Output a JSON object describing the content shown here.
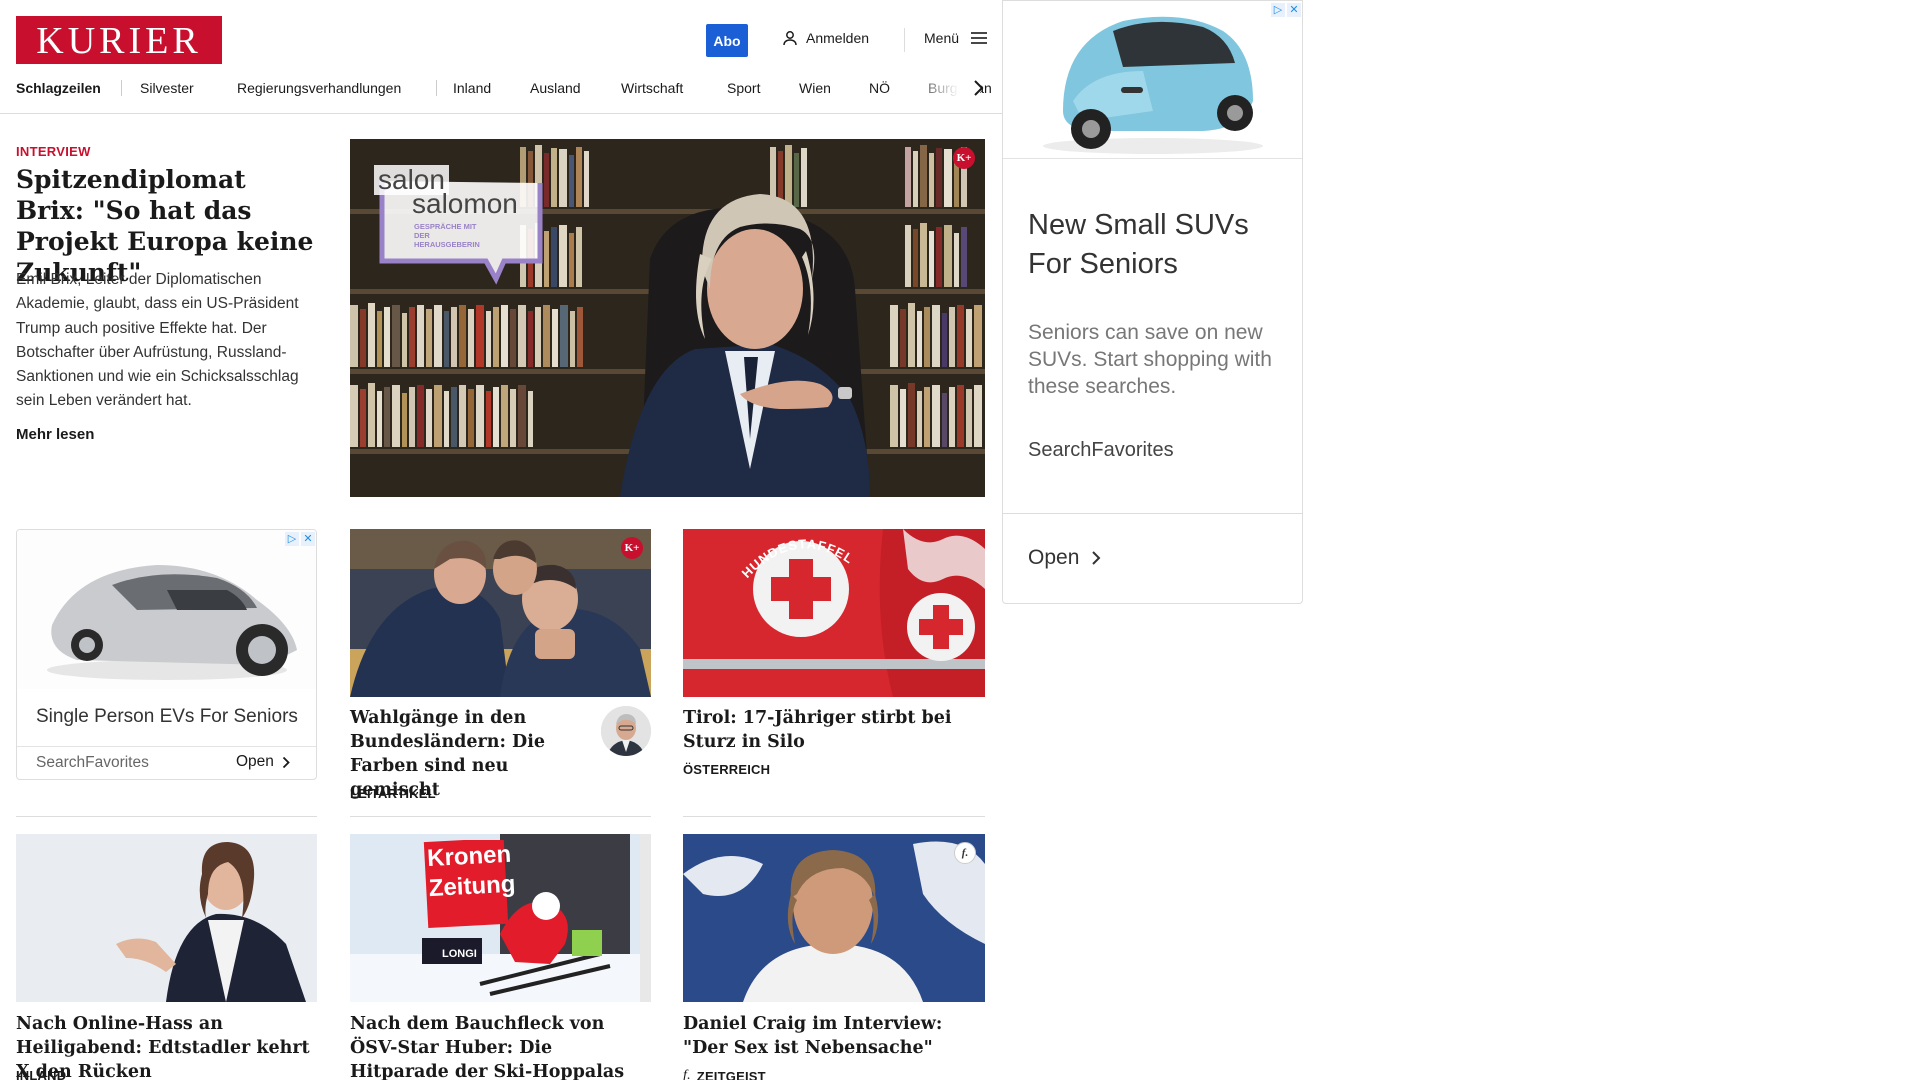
{
  "header": {
    "logo_text": "KURIER",
    "abo_label": "Abo",
    "login_label": "Anmelden",
    "menu_label": "Menü"
  },
  "nav": {
    "items": [
      "Schlagzeilen",
      "Silvester",
      "Regierungsverhandlungen",
      "Inland",
      "Ausland",
      "Wirtschaft",
      "Sport",
      "Wien",
      "NÖ",
      "Burgenland"
    ]
  },
  "hero": {
    "kicker": "INTERVIEW",
    "title": "Spitzendiplomat Brix: \"So hat das Projekt Europa keine Zukunft\"",
    "teaser": "Emil Brix, Leiter der Diplomatischen Akademie, glaubt, dass ein US-Präsident Trump auch positive Effekte hat. Der Botschafter über Aufrüstung, Russland-Sanktionen und wie ein Schicksalsschlag sein Leben verändert hat.",
    "read_more": "Mehr lesen",
    "overlay_brand_line1": "salon",
    "overlay_brand_line2": "salomon",
    "overlay_subtitle": "GESPRÄCHE MIT DER HERAUSGEBERIN",
    "premium_badge": "K+"
  },
  "articles": [
    {
      "title": "Wahlgänge in den Bundes­ländern: Die Farben sind neu gemischt",
      "category": "LEITARTIKEL",
      "badge": "K+"
    },
    {
      "title": "Tirol: 17-Jähriger stirbt bei Sturz in Silo",
      "category": "ÖSTERREICH",
      "image_text": "HUNDESTAFFEL"
    },
    {
      "title": "Nach Online-Hass an Heiligabend: Edtstadler kehrt X den Rücken",
      "category": "INLAND"
    },
    {
      "title": "Nach dem Bauchfleck von ÖSV-Star Huber: Die Hitparade der Ski-Hoppalas",
      "category": "",
      "image_text_1": "Kronen",
      "image_text_2": "Zeitung",
      "image_text_3": "LONGI"
    },
    {
      "title": "Daniel Craig im Interview: \"Der Sex ist Nebensache\"",
      "category": "ZEITGEIST",
      "category_icon_text": "f.",
      "badge": "f."
    }
  ],
  "ad_small": {
    "title": "Single Person EVs For Seniors",
    "source": "SearchFavorites",
    "open_label": "Open"
  },
  "ad_big": {
    "title": "New Small SUVs For Seniors",
    "description": "Seniors can save on new SUVs. Start shopping with these searches.",
    "source": "SearchFavorites",
    "open_label": "Open"
  },
  "colors": {
    "brand_red": "#c8102e",
    "abo_blue": "#1a5fd6"
  }
}
